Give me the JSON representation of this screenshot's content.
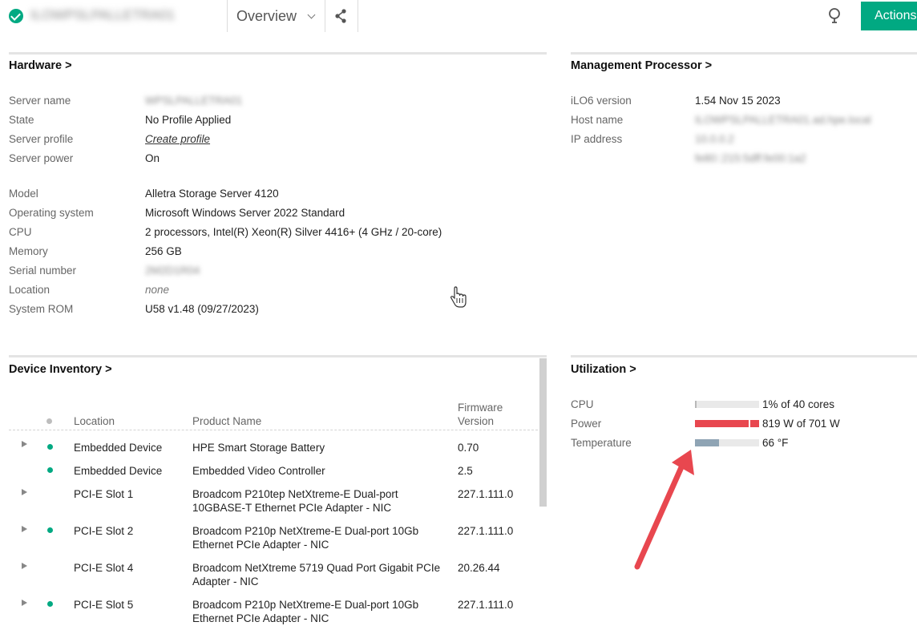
{
  "header": {
    "server_title": "ILOWPSLPALLETRA01",
    "view_label": "Overview",
    "actions_label": "Actions",
    "icons": {
      "status": "status-ok-icon",
      "share": "share-icon",
      "light": "bulb-icon"
    }
  },
  "hardware": {
    "title": "Hardware >",
    "rows": [
      {
        "label": "Server name",
        "value": "WPSLPALLETRA01"
      },
      {
        "label": "State",
        "value": "No Profile Applied"
      },
      {
        "label": "Server profile",
        "value": "Create profile"
      },
      {
        "label": "Server power",
        "value": "On"
      },
      {
        "label": "Model",
        "value": "Alletra Storage Server 4120"
      },
      {
        "label": "Operating system",
        "value": "Microsoft Windows Server 2022 Standard"
      },
      {
        "label": "CPU",
        "value": "2 processors, Intel(R) Xeon(R) Silver 4416+ (4 GHz / 20-core)"
      },
      {
        "label": "Memory",
        "value": "256 GB"
      },
      {
        "label": "Serial number",
        "value": "2M2D1R04"
      },
      {
        "label": "Location",
        "value": "none"
      },
      {
        "label": "System ROM",
        "value": "U58 v1.48 (09/27/2023)"
      }
    ]
  },
  "management": {
    "title": "Management Processor >",
    "rows": [
      {
        "label": "iLO6 version",
        "value": "1.54 Nov 15 2023"
      },
      {
        "label": "Host name",
        "value": "ILOWPSLPALLETRA01.ad.hpe.local"
      },
      {
        "label": "IP address",
        "value": "10.0.0.2"
      }
    ],
    "ip_secondary": "fe80::215:5dff:fe00:1a2"
  },
  "device_inventory": {
    "title": "Device Inventory >",
    "columns": {
      "location": "Location",
      "product": "Product Name",
      "firmware_line1": "Firmware",
      "firmware_line2": "Version"
    },
    "rows": [
      {
        "location": "Embedded Device",
        "product_l1": "HPE Smart Storage Battery",
        "product_l2": "",
        "firmware": "0.70"
      },
      {
        "location": "Embedded Device",
        "product_l1": "Embedded Video Controller",
        "product_l2": "",
        "firmware": "2.5"
      },
      {
        "location": "PCI-E Slot 1",
        "product_l1": "Broadcom P210tep NetXtreme-E Dual-port",
        "product_l2": "10GBASE-T Ethernet PCIe Adapter - NIC",
        "firmware": "227.1.111.0"
      },
      {
        "location": "PCI-E Slot 2",
        "product_l1": "Broadcom P210p NetXtreme-E Dual-port 10Gb",
        "product_l2": "Ethernet PCIe Adapter - NIC",
        "firmware": "227.1.111.0"
      },
      {
        "location": "PCI-E Slot 4",
        "product_l1": "Broadcom NetXtreme 5719 Quad Port Gigabit PCIe",
        "product_l2": "Adapter - NIC",
        "firmware": "20.26.44"
      },
      {
        "location": "PCI-E Slot 5",
        "product_l1": "Broadcom P210p NetXtreme-E Dual-port 10Gb",
        "product_l2": "Ethernet PCIe Adapter - NIC",
        "firmware": "227.1.111.0"
      }
    ]
  },
  "utilization": {
    "title": "Utilization >",
    "cpu": {
      "label": "CPU",
      "text": "1% of 40 cores",
      "fraction": 0.01,
      "color": "#b8b8b8"
    },
    "power": {
      "label": "Power",
      "text": "819 W of 701 W",
      "fraction": 1.0,
      "color": "#e8474f"
    },
    "temperature": {
      "label": "Temperature",
      "text": "66 °F",
      "fraction": 0.37,
      "color": "#8fa4b4"
    }
  },
  "colors": {
    "accent": "#01a982",
    "alert": "#e8474f",
    "annotation_arrow": "#e8474f"
  }
}
